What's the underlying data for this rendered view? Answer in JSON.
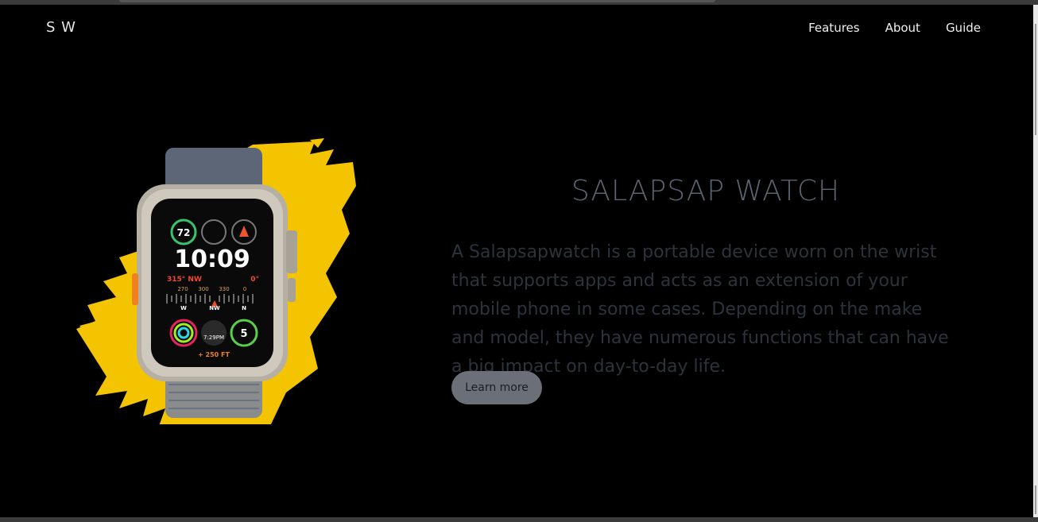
{
  "brand": {
    "logo": "S W"
  },
  "nav": {
    "items": [
      "Features",
      "About",
      "Guide"
    ]
  },
  "hero": {
    "title": "SALAPSAP WATCH",
    "description": "A Salapsapwatch is a portable device worn on the wrist that supports apps and acts as an extension of your mobile phone in some cases. Depending on the make and model, they have numerous functions that can have a big impact on day-to-day life.",
    "cta_label": "Learn more"
  },
  "watch_face": {
    "time": "10:09",
    "ring_value": "72",
    "heading": "315° NW",
    "degree": "0°",
    "scale": [
      "270",
      "300",
      "330",
      "0"
    ],
    "compass_letters": [
      "W",
      "NW",
      "N"
    ],
    "small_time": "7:29PM",
    "badge_value": "5",
    "elevation": "+ 250 FT"
  },
  "colors": {
    "background": "#000000",
    "accent_splash": "#f5c400",
    "title": "#5c6470",
    "description": "#2d333b",
    "button": "#6b7078"
  }
}
